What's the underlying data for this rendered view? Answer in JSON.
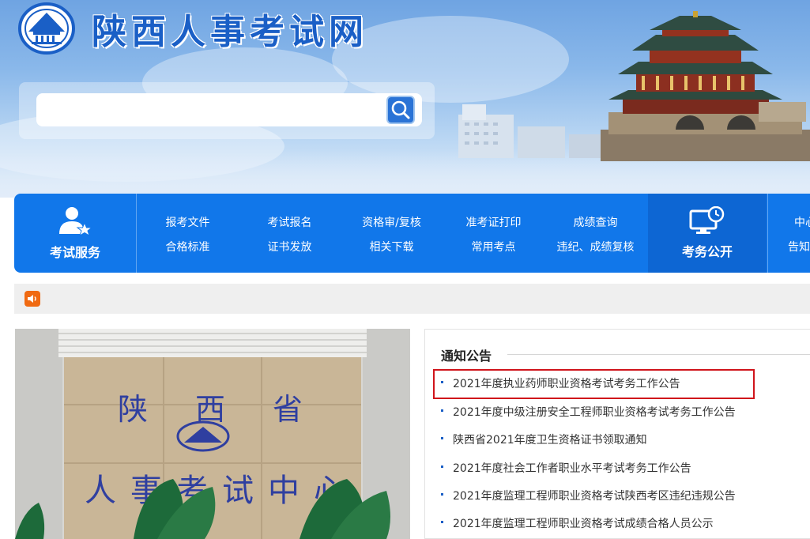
{
  "header": {
    "site_title": "陕西人事考试网",
    "logo_icon": "emblem-icon",
    "search": {
      "placeholder": "",
      "button_icon": "search-icon"
    }
  },
  "nav": {
    "service_label": "考试服务",
    "service_icon": "user-star-icon",
    "links": [
      "报考文件",
      "考试报名",
      "资格审/复核",
      "准考证打印",
      "成绩查询",
      "合格标准",
      "证书发放",
      "相关下载",
      "常用考点",
      "违纪、成绩复核"
    ],
    "public_label": "考务公开",
    "public_icon": "monitor-clock-icon",
    "right_links": [
      "中心",
      "告知"
    ]
  },
  "notice_bar": {
    "icon": "speaker-icon"
  },
  "notices": {
    "title": "通知公告",
    "items": [
      "2021年度执业药师职业资格考试考务工作公告",
      "2021年度中级注册安全工程师职业资格考试考务工作公告",
      "陕西省2021年度卫生资格证书领取通知",
      "2021年度社会工作者职业水平考试考务工作公告",
      "2021年度监理工程师职业资格考试陕西考区违纪违规公告",
      "2021年度监理工程师职业资格考试成绩合格人员公示"
    ]
  },
  "photo": {
    "sign_line1": "陕西省",
    "sign_line2": "人事考试中心"
  },
  "colors": {
    "brand_blue": "#1177ea",
    "title_blue": "#1a5fc6",
    "highlight_red": "#d0141b",
    "speaker_orange": "#f06a12"
  }
}
